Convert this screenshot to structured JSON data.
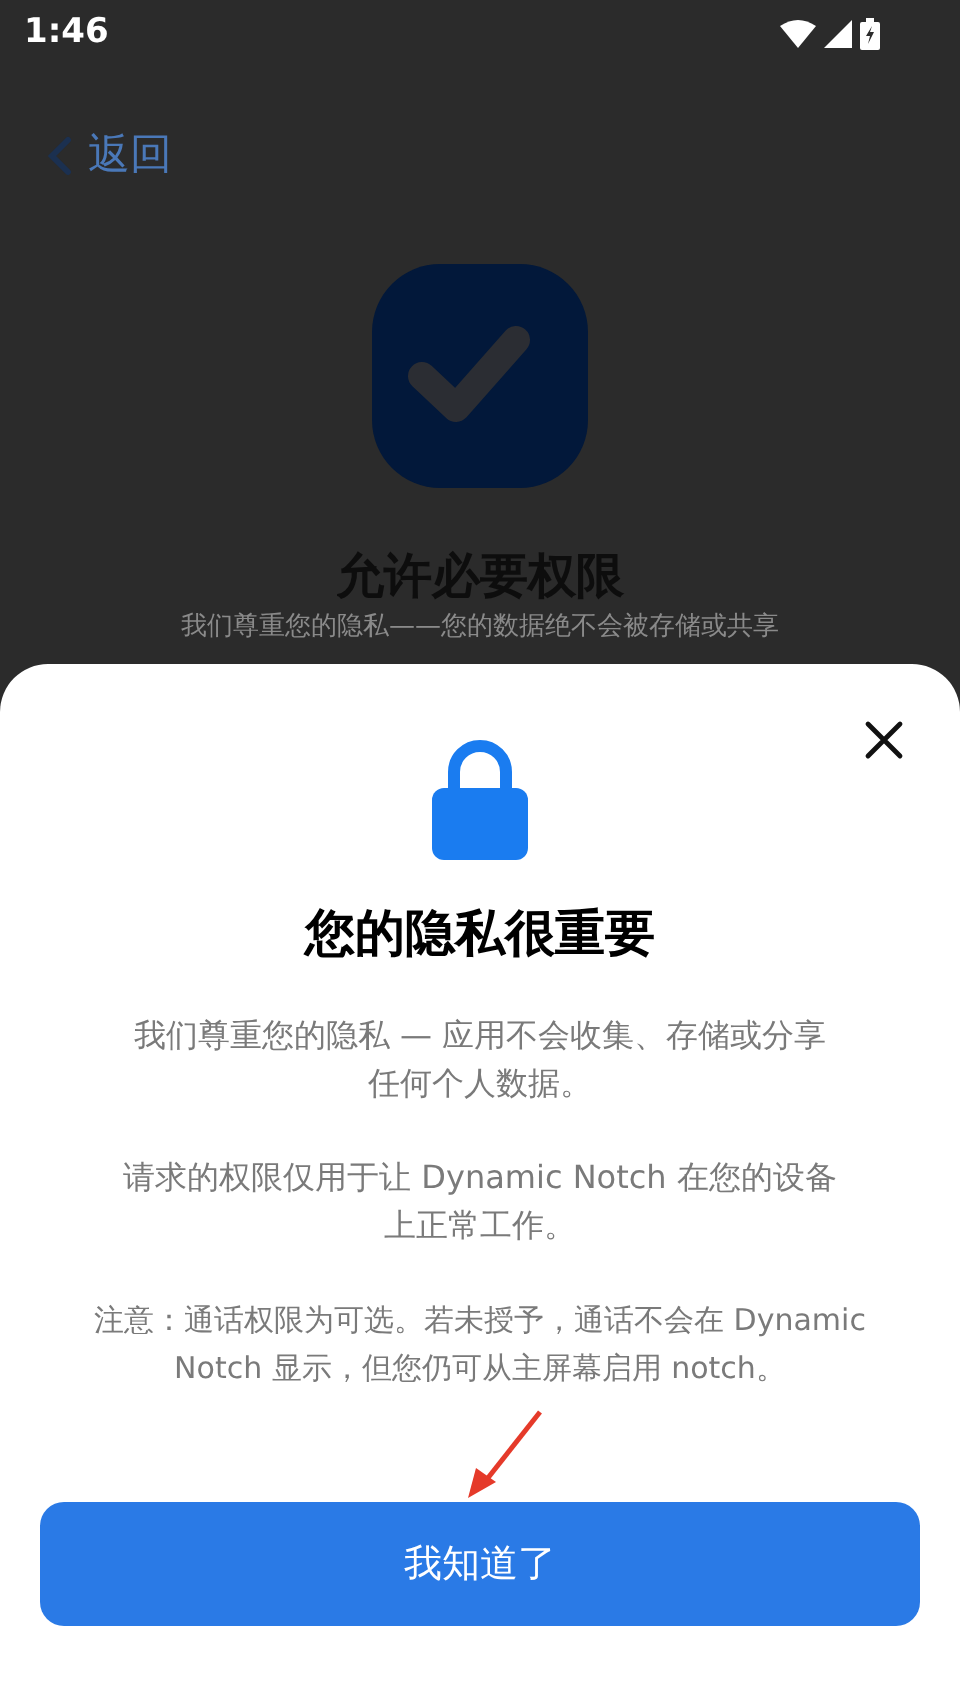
{
  "status_bar": {
    "time": "1:46"
  },
  "background_screen": {
    "back_label": "返回",
    "title": "允许必要权限",
    "subtitle": "我们尊重您的隐私——您的数据绝不会被存储或共享"
  },
  "sheet": {
    "title": "您的隐私很重要",
    "paragraphs": [
      {
        "kind": "body",
        "text": "我们尊重您的隐私 — 应用不会收集、存储或分享任何个人数据。"
      },
      {
        "kind": "body",
        "text": "请求的权限仅用于让 Dynamic Notch 在您的设备上正常工作。"
      },
      {
        "kind": "note",
        "text": "注意：通话权限为可选。若未授予，通话不会在 Dynamic Notch 显示，但您仍可从主屏幕启用 notch。"
      }
    ],
    "button": "我知道了"
  }
}
